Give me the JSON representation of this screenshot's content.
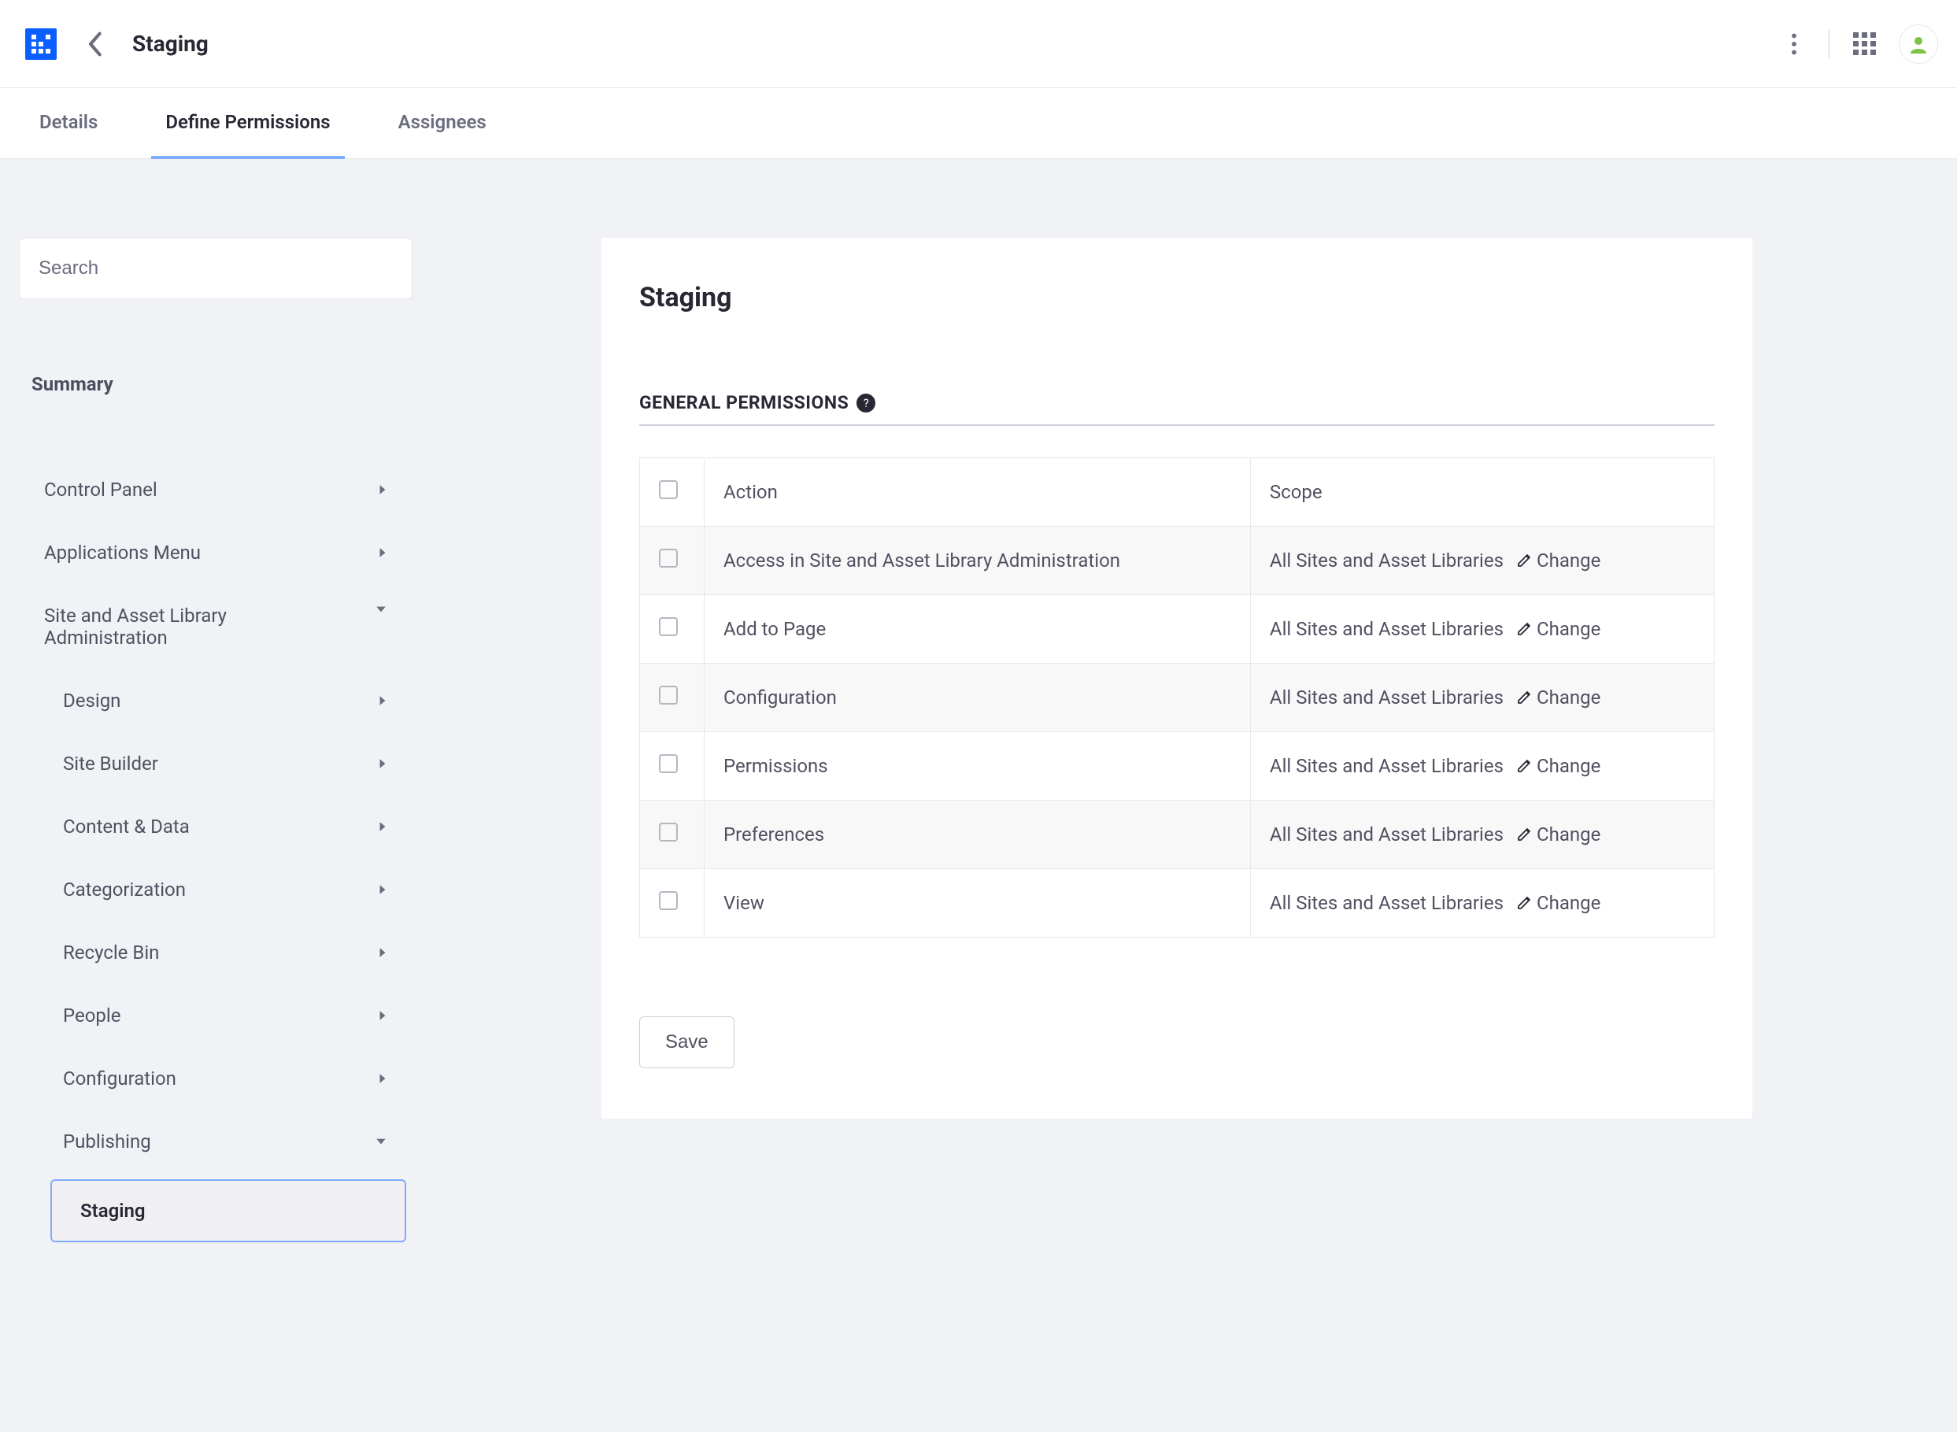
{
  "header": {
    "title": "Staging"
  },
  "tabs": {
    "details": "Details",
    "define": "Define Permissions",
    "assignees": "Assignees"
  },
  "sidebar": {
    "searchPlaceholder": "Search",
    "summary": "Summary",
    "items": {
      "controlPanel": "Control Panel",
      "appsMenu": "Applications Menu",
      "siteAdmin": "Site and Asset Library Administration",
      "design": "Design",
      "siteBuilder": "Site Builder",
      "contentData": "Content & Data",
      "categorization": "Categorization",
      "recycle": "Recycle Bin",
      "people": "People",
      "configuration": "Configuration",
      "publishing": "Publishing",
      "staging": "Staging"
    }
  },
  "panel": {
    "title": "Staging",
    "sectionTitle": "GENERAL PERMISSIONS",
    "helpGlyph": "?",
    "columns": {
      "action": "Action",
      "scope": "Scope"
    },
    "rows": [
      {
        "action": "Access in Site and Asset Library Administration",
        "scope": "All Sites and Asset Libraries",
        "change": "Change"
      },
      {
        "action": "Add to Page",
        "scope": "All Sites and Asset Libraries",
        "change": "Change"
      },
      {
        "action": "Configuration",
        "scope": "All Sites and Asset Libraries",
        "change": "Change"
      },
      {
        "action": "Permissions",
        "scope": "All Sites and Asset Libraries",
        "change": "Change"
      },
      {
        "action": "Preferences",
        "scope": "All Sites and Asset Libraries",
        "change": "Change"
      },
      {
        "action": "View",
        "scope": "All Sites and Asset Libraries",
        "change": "Change"
      }
    ],
    "save": "Save"
  }
}
